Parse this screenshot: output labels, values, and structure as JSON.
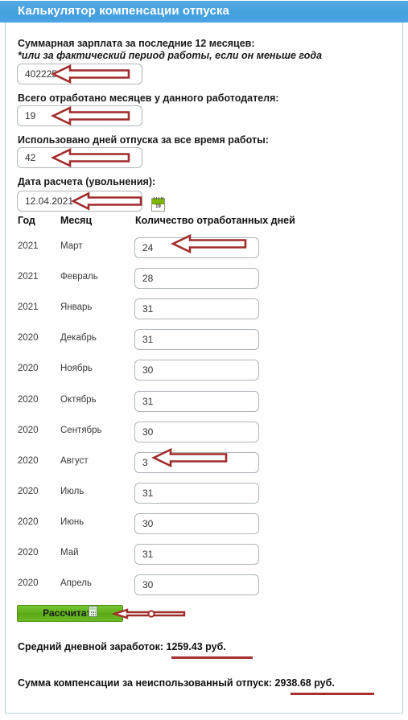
{
  "header": {
    "title": "Калькулятор компенсации отпуска",
    "bg_color": "#4aa4e2"
  },
  "form": {
    "salary_label": "Суммарная зарплата за последние 12 месяцев:",
    "salary_note": "*или за фактический период работы, если он меньше года",
    "salary_value": "402225",
    "months_label": "Всего отработано месяцев у данного работодателя:",
    "months_value": "19",
    "used_days_label": "Использовано дней отпуска за все время работы:",
    "used_days_value": "42",
    "date_label": "Дата расчета (увольнения):",
    "date_value": "12.04.2021",
    "calendar_icon_day": "19"
  },
  "table": {
    "headers": {
      "year": "Год",
      "month": "Месяц",
      "days": "Количество отработанных дней"
    },
    "rows": [
      {
        "year": "2021",
        "month": "Март",
        "days": "24"
      },
      {
        "year": "2021",
        "month": "Февраль",
        "days": "28"
      },
      {
        "year": "2021",
        "month": "Январь",
        "days": "31"
      },
      {
        "year": "2020",
        "month": "Декабрь",
        "days": "31"
      },
      {
        "year": "2020",
        "month": "Ноябрь",
        "days": "30"
      },
      {
        "year": "2020",
        "month": "Октябрь",
        "days": "31"
      },
      {
        "year": "2020",
        "month": "Сентябрь",
        "days": "30"
      },
      {
        "year": "2020",
        "month": "Август",
        "days": "3"
      },
      {
        "year": "2020",
        "month": "Июль",
        "days": "31"
      },
      {
        "year": "2020",
        "month": "Июнь",
        "days": "30"
      },
      {
        "year": "2020",
        "month": "Май",
        "days": "31"
      },
      {
        "year": "2020",
        "month": "Апрель",
        "days": "30"
      }
    ]
  },
  "actions": {
    "calculate_label": "Рассчитать"
  },
  "results": {
    "avg_daily_label": "Средний дневной заработок:",
    "avg_daily_value": "1259.43 руб.",
    "avg_daily_full": "Средний дневной заработок: 1259.43 руб.",
    "compensation_label": "Сумма компенсации за неиспользованный отпуск:",
    "compensation_value": "2938.68 руб.",
    "compensation_full": "Сумма компенсации за неиспользованный отпуск: 2938.68 руб.",
    "highlight_color": "#a63030"
  },
  "annotations": {
    "arrow_color": "#a02c2c",
    "count": 7
  }
}
